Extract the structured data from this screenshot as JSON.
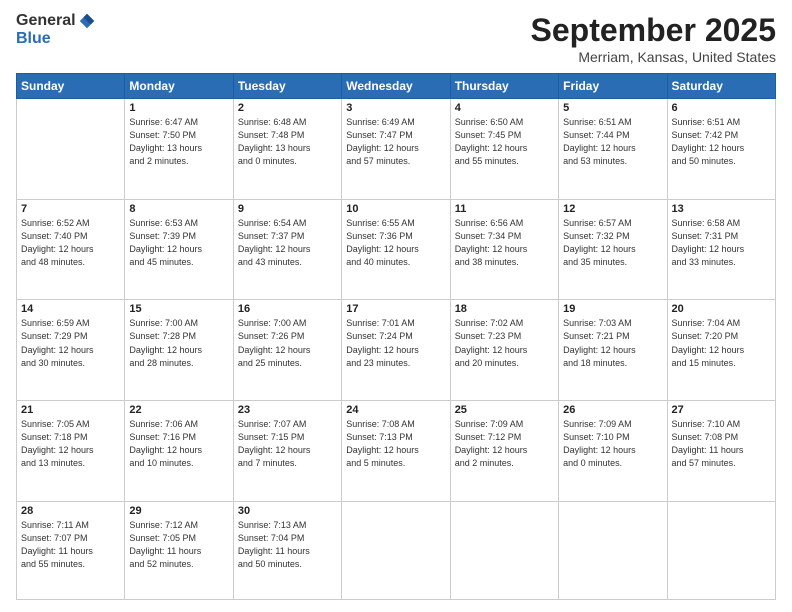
{
  "header": {
    "logo_general": "General",
    "logo_blue": "Blue",
    "month_title": "September 2025",
    "location": "Merriam, Kansas, United States"
  },
  "days_of_week": [
    "Sunday",
    "Monday",
    "Tuesday",
    "Wednesday",
    "Thursday",
    "Friday",
    "Saturday"
  ],
  "weeks": [
    [
      {
        "day": "",
        "sunrise": "",
        "sunset": "",
        "daylight": ""
      },
      {
        "day": "1",
        "sunrise": "Sunrise: 6:47 AM",
        "sunset": "Sunset: 7:50 PM",
        "daylight": "Daylight: 13 hours and 2 minutes."
      },
      {
        "day": "2",
        "sunrise": "Sunrise: 6:48 AM",
        "sunset": "Sunset: 7:48 PM",
        "daylight": "Daylight: 13 hours and 0 minutes."
      },
      {
        "day": "3",
        "sunrise": "Sunrise: 6:49 AM",
        "sunset": "Sunset: 7:47 PM",
        "daylight": "Daylight: 12 hours and 57 minutes."
      },
      {
        "day": "4",
        "sunrise": "Sunrise: 6:50 AM",
        "sunset": "Sunset: 7:45 PM",
        "daylight": "Daylight: 12 hours and 55 minutes."
      },
      {
        "day": "5",
        "sunrise": "Sunrise: 6:51 AM",
        "sunset": "Sunset: 7:44 PM",
        "daylight": "Daylight: 12 hours and 53 minutes."
      },
      {
        "day": "6",
        "sunrise": "Sunrise: 6:51 AM",
        "sunset": "Sunset: 7:42 PM",
        "daylight": "Daylight: 12 hours and 50 minutes."
      }
    ],
    [
      {
        "day": "7",
        "sunrise": "Sunrise: 6:52 AM",
        "sunset": "Sunset: 7:40 PM",
        "daylight": "Daylight: 12 hours and 48 minutes."
      },
      {
        "day": "8",
        "sunrise": "Sunrise: 6:53 AM",
        "sunset": "Sunset: 7:39 PM",
        "daylight": "Daylight: 12 hours and 45 minutes."
      },
      {
        "day": "9",
        "sunrise": "Sunrise: 6:54 AM",
        "sunset": "Sunset: 7:37 PM",
        "daylight": "Daylight: 12 hours and 43 minutes."
      },
      {
        "day": "10",
        "sunrise": "Sunrise: 6:55 AM",
        "sunset": "Sunset: 7:36 PM",
        "daylight": "Daylight: 12 hours and 40 minutes."
      },
      {
        "day": "11",
        "sunrise": "Sunrise: 6:56 AM",
        "sunset": "Sunset: 7:34 PM",
        "daylight": "Daylight: 12 hours and 38 minutes."
      },
      {
        "day": "12",
        "sunrise": "Sunrise: 6:57 AM",
        "sunset": "Sunset: 7:32 PM",
        "daylight": "Daylight: 12 hours and 35 minutes."
      },
      {
        "day": "13",
        "sunrise": "Sunrise: 6:58 AM",
        "sunset": "Sunset: 7:31 PM",
        "daylight": "Daylight: 12 hours and 33 minutes."
      }
    ],
    [
      {
        "day": "14",
        "sunrise": "Sunrise: 6:59 AM",
        "sunset": "Sunset: 7:29 PM",
        "daylight": "Daylight: 12 hours and 30 minutes."
      },
      {
        "day": "15",
        "sunrise": "Sunrise: 7:00 AM",
        "sunset": "Sunset: 7:28 PM",
        "daylight": "Daylight: 12 hours and 28 minutes."
      },
      {
        "day": "16",
        "sunrise": "Sunrise: 7:00 AM",
        "sunset": "Sunset: 7:26 PM",
        "daylight": "Daylight: 12 hours and 25 minutes."
      },
      {
        "day": "17",
        "sunrise": "Sunrise: 7:01 AM",
        "sunset": "Sunset: 7:24 PM",
        "daylight": "Daylight: 12 hours and 23 minutes."
      },
      {
        "day": "18",
        "sunrise": "Sunrise: 7:02 AM",
        "sunset": "Sunset: 7:23 PM",
        "daylight": "Daylight: 12 hours and 20 minutes."
      },
      {
        "day": "19",
        "sunrise": "Sunrise: 7:03 AM",
        "sunset": "Sunset: 7:21 PM",
        "daylight": "Daylight: 12 hours and 18 minutes."
      },
      {
        "day": "20",
        "sunrise": "Sunrise: 7:04 AM",
        "sunset": "Sunset: 7:20 PM",
        "daylight": "Daylight: 12 hours and 15 minutes."
      }
    ],
    [
      {
        "day": "21",
        "sunrise": "Sunrise: 7:05 AM",
        "sunset": "Sunset: 7:18 PM",
        "daylight": "Daylight: 12 hours and 13 minutes."
      },
      {
        "day": "22",
        "sunrise": "Sunrise: 7:06 AM",
        "sunset": "Sunset: 7:16 PM",
        "daylight": "Daylight: 12 hours and 10 minutes."
      },
      {
        "day": "23",
        "sunrise": "Sunrise: 7:07 AM",
        "sunset": "Sunset: 7:15 PM",
        "daylight": "Daylight: 12 hours and 7 minutes."
      },
      {
        "day": "24",
        "sunrise": "Sunrise: 7:08 AM",
        "sunset": "Sunset: 7:13 PM",
        "daylight": "Daylight: 12 hours and 5 minutes."
      },
      {
        "day": "25",
        "sunrise": "Sunrise: 7:09 AM",
        "sunset": "Sunset: 7:12 PM",
        "daylight": "Daylight: 12 hours and 2 minutes."
      },
      {
        "day": "26",
        "sunrise": "Sunrise: 7:09 AM",
        "sunset": "Sunset: 7:10 PM",
        "daylight": "Daylight: 12 hours and 0 minutes."
      },
      {
        "day": "27",
        "sunrise": "Sunrise: 7:10 AM",
        "sunset": "Sunset: 7:08 PM",
        "daylight": "Daylight: 11 hours and 57 minutes."
      }
    ],
    [
      {
        "day": "28",
        "sunrise": "Sunrise: 7:11 AM",
        "sunset": "Sunset: 7:07 PM",
        "daylight": "Daylight: 11 hours and 55 minutes."
      },
      {
        "day": "29",
        "sunrise": "Sunrise: 7:12 AM",
        "sunset": "Sunset: 7:05 PM",
        "daylight": "Daylight: 11 hours and 52 minutes."
      },
      {
        "day": "30",
        "sunrise": "Sunrise: 7:13 AM",
        "sunset": "Sunset: 7:04 PM",
        "daylight": "Daylight: 11 hours and 50 minutes."
      },
      {
        "day": "",
        "sunrise": "",
        "sunset": "",
        "daylight": ""
      },
      {
        "day": "",
        "sunrise": "",
        "sunset": "",
        "daylight": ""
      },
      {
        "day": "",
        "sunrise": "",
        "sunset": "",
        "daylight": ""
      },
      {
        "day": "",
        "sunrise": "",
        "sunset": "",
        "daylight": ""
      }
    ]
  ]
}
